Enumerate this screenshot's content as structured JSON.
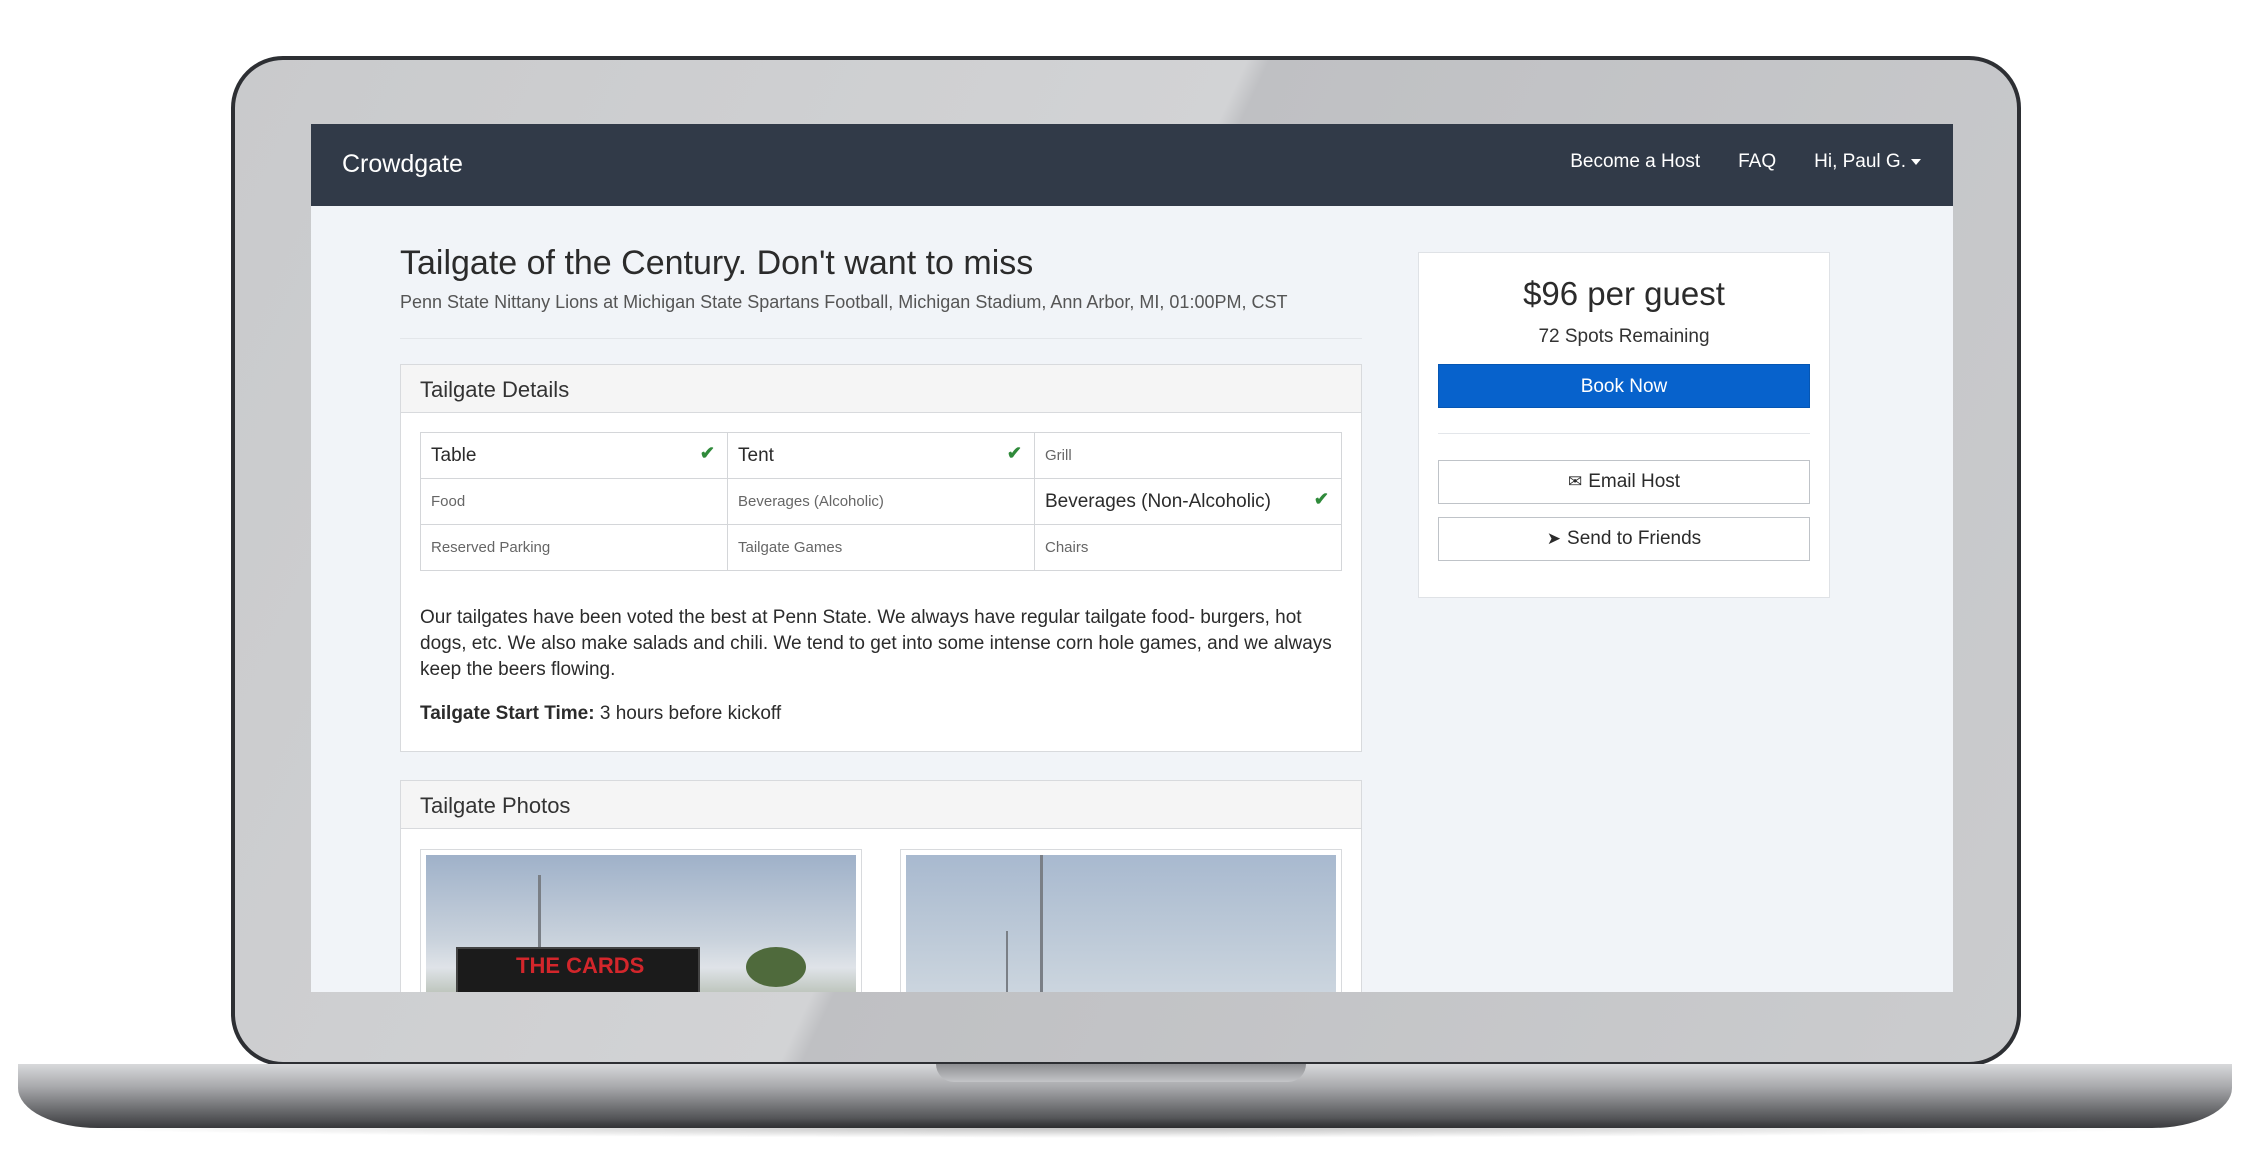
{
  "navbar": {
    "brand": "Crowdgate",
    "links": [
      {
        "label": "Become a Host"
      },
      {
        "label": "FAQ"
      },
      {
        "label": "Hi, Paul G."
      }
    ]
  },
  "event": {
    "title": "Tailgate of the Century. Don't want to miss",
    "subtitle": "Penn State Nittany Lions at Michigan State Spartans Football, Michigan Stadium, Ann Arbor, MI, 01:00PM, CST"
  },
  "details": {
    "heading": "Tailgate Details",
    "amenities": [
      {
        "label": "Table",
        "included": true
      },
      {
        "label": "Tent",
        "included": true
      },
      {
        "label": "Grill",
        "included": false
      },
      {
        "label": "Food",
        "included": false
      },
      {
        "label": "Beverages (Alcoholic)",
        "included": false
      },
      {
        "label": "Beverages (Non-Alcoholic)",
        "included": true
      },
      {
        "label": "Reserved Parking",
        "included": false
      },
      {
        "label": "Tailgate Games",
        "included": false
      },
      {
        "label": "Chairs",
        "included": false
      }
    ],
    "description": "Our tailgates have been voted the best at Penn State. We always have regular tailgate food- burgers, hot dogs, etc. We also make salads and chili. We tend to get into some intense corn hole games, and we always keep the beers flowing.",
    "start_time_label": "Tailgate Start Time:",
    "start_time_value": "3 hours before kickoff"
  },
  "photos": {
    "heading": "Tailgate Photos",
    "photo1_sign": "THE CARDS"
  },
  "booking": {
    "price": "$96 per guest",
    "spots": "72 Spots Remaining",
    "book_label": "Book Now",
    "email_label": "Email Host",
    "send_label": "Send to Friends"
  },
  "colors": {
    "navbar": "#313a48",
    "primary_button": "#0762cc",
    "check": "#2f8a3a"
  },
  "icons": {
    "check": "check-icon",
    "email": "envelope-icon",
    "send": "paper-plane-icon"
  }
}
